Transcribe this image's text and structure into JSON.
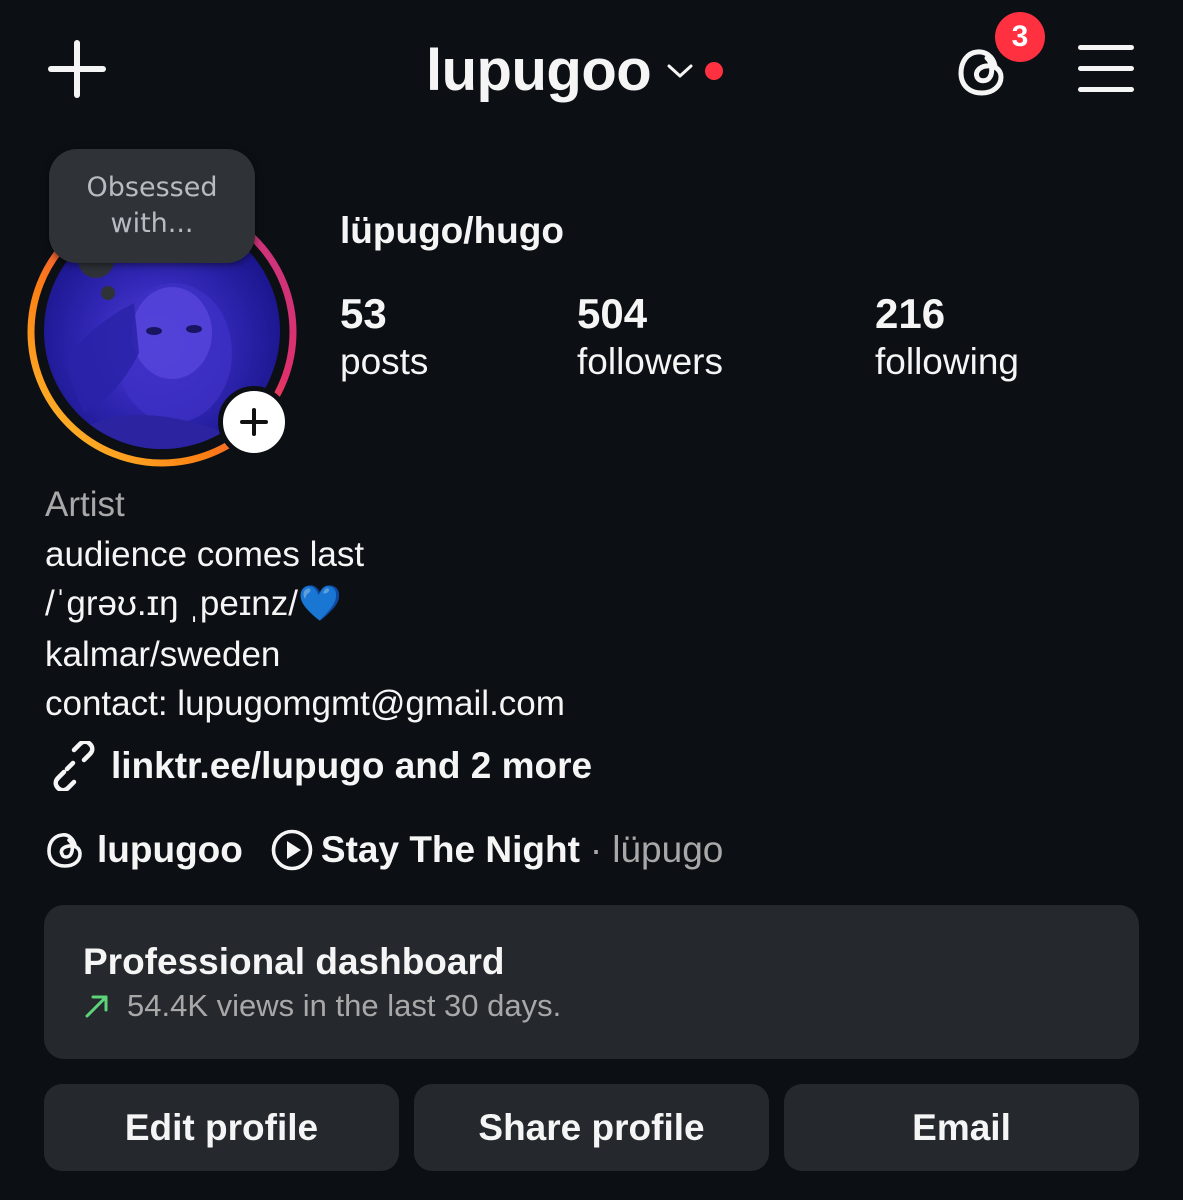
{
  "header": {
    "username": "lupugoo",
    "notification_count": "3",
    "colors": {
      "live_dot": "#ff3040",
      "badge": "#ff3040"
    },
    "icons": [
      "plus-icon",
      "chevron-down-icon",
      "threads-icon",
      "menu-icon"
    ]
  },
  "profile": {
    "note": "Obsessed with...",
    "display_name": "lüpugo/hugo",
    "stats": [
      {
        "count": "53",
        "label": "posts"
      },
      {
        "count": "504",
        "label": "followers"
      },
      {
        "count": "216",
        "label": "following"
      }
    ]
  },
  "bio": {
    "category": "Artist",
    "line1": "audience comes last",
    "line2": "/ˈgrəʊ.ɪŋ ˌpeɪnz/",
    "heart": "💙",
    "line3": "kalmar/sweden",
    "line4": "contact: lupugomgmt@gmail.com"
  },
  "links": {
    "text": "linktr.ee/lupugo and 2 more"
  },
  "chips": {
    "threads_handle": "lupugoo",
    "song_title": "Stay The Night",
    "separator": "·",
    "song_artist": "lüpugo"
  },
  "dashboard": {
    "title": "Professional dashboard",
    "subtitle": "54.4K views in the last 30 days.",
    "trend_color": "#5ed37a"
  },
  "actions": {
    "edit": "Edit profile",
    "share": "Share profile",
    "email": "Email"
  },
  "theme": {
    "background": "#0c1014",
    "surface": "#25292e",
    "text": "#f5f5f5",
    "secondary_text": "#a8a8a8"
  }
}
